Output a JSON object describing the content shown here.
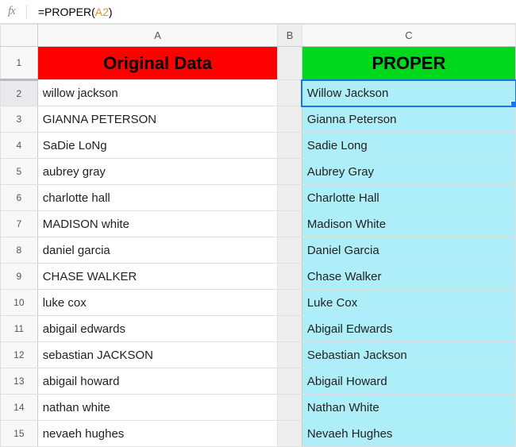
{
  "formula_bar": {
    "fx_label": "fx",
    "prefix": "=PROPER(",
    "ref": "A2",
    "suffix": ")"
  },
  "columns": {
    "a": "A",
    "b": "B",
    "c": "C"
  },
  "headers": {
    "original": "Original Data",
    "proper": "PROPER"
  },
  "row_numbers": [
    "1",
    "2",
    "3",
    "4",
    "5",
    "6",
    "7",
    "8",
    "9",
    "10",
    "11",
    "12",
    "13",
    "14",
    "15"
  ],
  "rows": [
    {
      "orig": "willow jackson",
      "proper": "Willow Jackson"
    },
    {
      "orig": "GIANNA PETERSON",
      "proper": "Gianna Peterson"
    },
    {
      "orig": "SaDie LoNg",
      "proper": "Sadie Long"
    },
    {
      "orig": "aubrey gray",
      "proper": "Aubrey Gray"
    },
    {
      "orig": "charlotte hall",
      "proper": "Charlotte Hall"
    },
    {
      "orig": "MADISON white",
      "proper": "Madison White"
    },
    {
      "orig": "daniel garcia",
      "proper": "Daniel Garcia"
    },
    {
      "orig": "CHASE WALKER",
      "proper": "Chase Walker"
    },
    {
      "orig": "luke cox",
      "proper": "Luke Cox"
    },
    {
      "orig": "abigail edwards",
      "proper": "Abigail Edwards"
    },
    {
      "orig": "sebastian JACKSON",
      "proper": "Sebastian Jackson"
    },
    {
      "orig": "abigail howard",
      "proper": "Abigail Howard"
    },
    {
      "orig": "nathan white",
      "proper": "Nathan White"
    },
    {
      "orig": "nevaeh hughes",
      "proper": "Nevaeh Hughes"
    }
  ]
}
